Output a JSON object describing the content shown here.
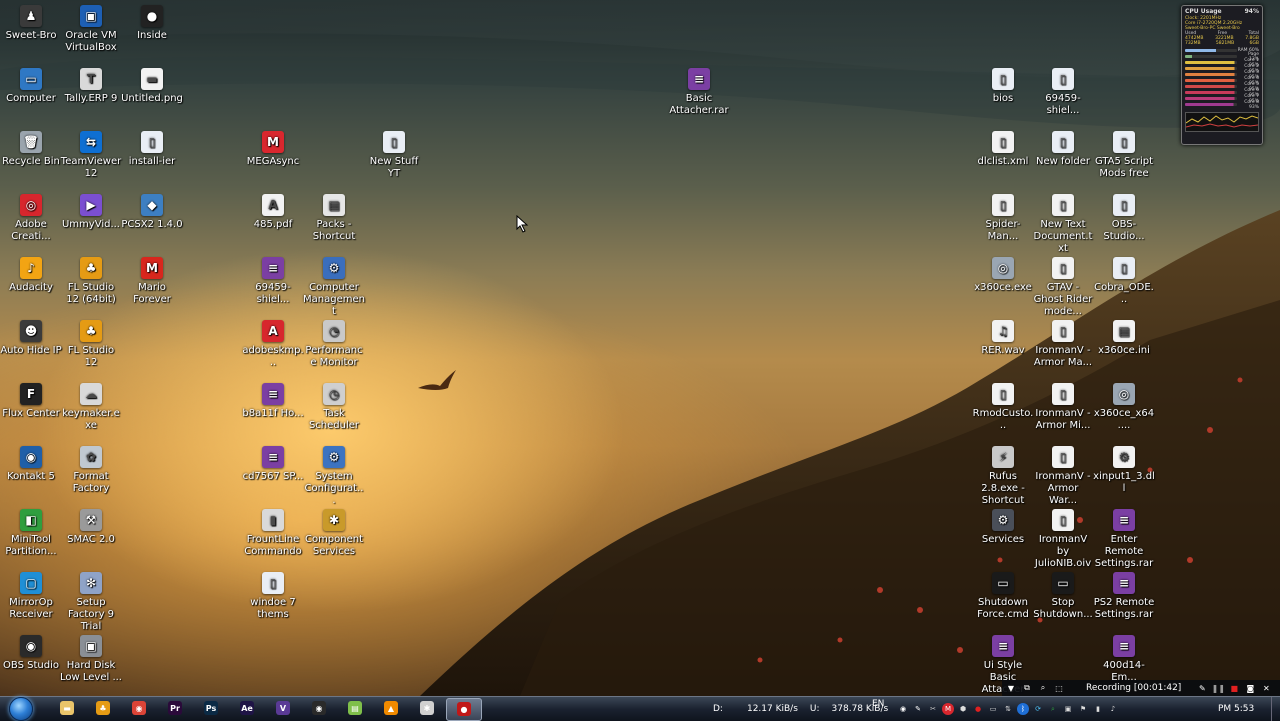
{
  "desktop": {
    "icons": [
      {
        "label": "Sweet-Bro",
        "icon": "user-folder-icon",
        "color": "#3a3a3a",
        "glyph": "♟"
      },
      {
        "label": "Oracle VM VirtualBox",
        "icon": "virtualbox-icon",
        "color": "#1d5fb4",
        "glyph": "▣"
      },
      {
        "label": "Inside",
        "icon": "game-icon",
        "color": "#222222",
        "glyph": "●"
      },
      {
        "label": "Computer",
        "icon": "computer-icon",
        "color": "#2f78c4",
        "glyph": "▭"
      },
      {
        "label": "Tally.ERP 9",
        "icon": "tally-icon",
        "color": "#d9d9d9",
        "glyph": "T"
      },
      {
        "label": "Untitled.png",
        "icon": "image-file-icon",
        "color": "#f2f2f2",
        "glyph": "▬"
      },
      {
        "label": "Recycle Bin",
        "icon": "recycle-bin-icon",
        "color": "#9aa4ad",
        "glyph": "🗑"
      },
      {
        "label": "TeamViewer 12",
        "icon": "teamviewer-icon",
        "color": "#0e6fd2",
        "glyph": "⇆"
      },
      {
        "label": "install-ier",
        "icon": "folder-icon",
        "color": "#e9eef5",
        "glyph": "▯"
      },
      {
        "label": "MEGAsync",
        "icon": "mega-icon",
        "color": "#d9272e",
        "glyph": "M"
      },
      {
        "label": "New Stuff YT",
        "icon": "folder-icon",
        "color": "#e9eef5",
        "glyph": "▯"
      },
      {
        "label": "Basic Attacher.rar",
        "icon": "rar-archive-icon",
        "color": "#7b3fa3",
        "glyph": "≡"
      },
      {
        "label": "bios",
        "icon": "folder-icon",
        "color": "#e9eef5",
        "glyph": "▯"
      },
      {
        "label": "69459-shiel...",
        "icon": "folder-icon",
        "color": "#e9eef5",
        "glyph": "▯"
      },
      {
        "label": "Adobe Creati...",
        "icon": "adobe-cc-icon",
        "color": "#d7262d",
        "glyph": "◎"
      },
      {
        "label": "UmmyVid...",
        "icon": "ummy-icon",
        "color": "#7b4fd1",
        "glyph": "▶"
      },
      {
        "label": "PCSX2 1.4.0",
        "icon": "pcsx2-icon",
        "color": "#3d7fc2",
        "glyph": "◆"
      },
      {
        "label": "485.pdf",
        "icon": "pdf-file-icon",
        "color": "#f2f2f2",
        "glyph": "A"
      },
      {
        "label": "Packs - Shortcut",
        "icon": "shortcut-icon",
        "color": "#e6e6e6",
        "glyph": "▤"
      },
      {
        "label": "69459-shiel...",
        "icon": "rar-archive-icon",
        "color": "#7b3fa3",
        "glyph": "≡"
      },
      {
        "label": "Computer Management",
        "icon": "computer-management-icon",
        "color": "#3a6ebd",
        "glyph": "⚙"
      },
      {
        "label": "Audacity",
        "icon": "audacity-icon",
        "color": "#f2a413",
        "glyph": "♪"
      },
      {
        "label": "FL Studio 12 (64bit)",
        "icon": "fl-studio-icon",
        "color": "#e59b14",
        "glyph": "♣"
      },
      {
        "label": "Mario Forever",
        "icon": "mario-icon",
        "color": "#d8261d",
        "glyph": "M"
      },
      {
        "label": "Auto Hide IP",
        "icon": "auto-hide-ip-icon",
        "color": "#3b3b3b",
        "glyph": "☻"
      },
      {
        "label": "FL Studio 12",
        "icon": "fl-studio-icon",
        "color": "#e59b14",
        "glyph": "♣"
      },
      {
        "label": "adobeskmp...",
        "icon": "adobe-file-icon",
        "color": "#d7262d",
        "glyph": "A"
      },
      {
        "label": "Performance Monitor",
        "icon": "performance-monitor-icon",
        "color": "#c9c9c9",
        "glyph": "◔"
      },
      {
        "label": "Flux Center",
        "icon": "flux-icon",
        "color": "#222222",
        "glyph": "F"
      },
      {
        "label": "keymaker.exe",
        "icon": "keymaker-icon",
        "color": "#d9d9d9",
        "glyph": "☁"
      },
      {
        "label": "b8a11f Ho...",
        "icon": "rar-archive-icon",
        "color": "#7b3fa3",
        "glyph": "≡"
      },
      {
        "label": "Task Scheduler",
        "icon": "task-scheduler-icon",
        "color": "#cfcfcf",
        "glyph": "◷"
      },
      {
        "label": "Kontakt 5",
        "icon": "kontakt-icon",
        "color": "#1f5fa8",
        "glyph": "◉"
      },
      {
        "label": "Format Factory",
        "icon": "format-factory-icon",
        "color": "#c0c8d0",
        "glyph": "✿"
      },
      {
        "label": "cd7567 SP...",
        "icon": "rar-archive-icon",
        "color": "#7b3fa3",
        "glyph": "≡"
      },
      {
        "label": "System Configurat...",
        "icon": "system-config-icon",
        "color": "#3c73c0",
        "glyph": "⚙"
      },
      {
        "label": "MiniTool Partition...",
        "icon": "minitool-icon",
        "color": "#2f9e3f",
        "glyph": "◧"
      },
      {
        "label": "SMAC 2.0",
        "icon": "smac-icon",
        "color": "#9a9a9a",
        "glyph": "⚒"
      },
      {
        "label": "FrountLine Commando",
        "icon": "game-shortcut-icon",
        "color": "#d9d9d9",
        "glyph": "▮"
      },
      {
        "label": "Component Services",
        "icon": "component-services-icon",
        "color": "#c99a2a",
        "glyph": "✱"
      },
      {
        "label": "MirrorOp Receiver",
        "icon": "mirrorop-icon",
        "color": "#1f8fd6",
        "glyph": "▢"
      },
      {
        "label": "Setup Factory 9 Trial",
        "icon": "setup-factory-icon",
        "color": "#8fa3c7",
        "glyph": "✻"
      },
      {
        "label": "windoe 7 thems",
        "icon": "folder-icon",
        "color": "#e9eef5",
        "glyph": "▯"
      },
      {
        "label": "OBS Studio",
        "icon": "obs-icon",
        "color": "#2a2a2a",
        "glyph": "◉"
      },
      {
        "label": "Hard Disk Low Level ...",
        "icon": "hard-disk-icon",
        "color": "#8a8f96",
        "glyph": "▣"
      },
      {
        "label": "dlclist.xml",
        "icon": "xml-file-icon",
        "color": "#f2f2f2",
        "glyph": "▯"
      },
      {
        "label": "New folder",
        "icon": "folder-icon",
        "color": "#e9eef5",
        "glyph": "▯"
      },
      {
        "label": "GTA5 Script Mods free",
        "icon": "folder-icon",
        "color": "#e9eef5",
        "glyph": "▯"
      },
      {
        "label": "Spider-Man...",
        "icon": "text-file-icon",
        "color": "#f2f2f2",
        "glyph": "▯"
      },
      {
        "label": "New Text Document.txt",
        "icon": "text-file-icon",
        "color": "#f2f2f2",
        "glyph": "▯"
      },
      {
        "label": "OBS-Studio...",
        "icon": "folder-icon",
        "color": "#e9eef5",
        "glyph": "▯"
      },
      {
        "label": "x360ce.exe",
        "icon": "gamepad-icon",
        "color": "#9aa6b3",
        "glyph": "◎"
      },
      {
        "label": "GTAV - Ghost Rider mode...",
        "icon": "text-file-icon",
        "color": "#f2f2f2",
        "glyph": "▯"
      },
      {
        "label": "Cobra_ODE...",
        "icon": "folder-icon",
        "color": "#e9eef5",
        "glyph": "▯"
      },
      {
        "label": "RER.wav",
        "icon": "audio-file-icon",
        "color": "#f2f2f2",
        "glyph": "♫"
      },
      {
        "label": "IronmanV - Armor Ma...",
        "icon": "text-file-icon",
        "color": "#f2f2f2",
        "glyph": "▯"
      },
      {
        "label": "x360ce.ini",
        "icon": "ini-file-icon",
        "color": "#f2f2f2",
        "glyph": "▤"
      },
      {
        "label": "RmodCusto...",
        "icon": "text-file-icon",
        "color": "#f2f2f2",
        "glyph": "▯"
      },
      {
        "label": "IronmanV - Armor Mi...",
        "icon": "text-file-icon",
        "color": "#f2f2f2",
        "glyph": "▯"
      },
      {
        "label": "x360ce_x64....",
        "icon": "gamepad-icon",
        "color": "#9aa6b3",
        "glyph": "◎"
      },
      {
        "label": "Rufus 2.8.exe - Shortcut",
        "icon": "rufus-icon",
        "color": "#c9c9c9",
        "glyph": "⚡"
      },
      {
        "label": "IronmanV - Armor War...",
        "icon": "text-file-icon",
        "color": "#f2f2f2",
        "glyph": "▯"
      },
      {
        "label": "xinput1_3.dll",
        "icon": "dll-file-icon",
        "color": "#f2f2f2",
        "glyph": "⚙"
      },
      {
        "label": "Services",
        "icon": "services-gear-icon",
        "color": "#4a4f59",
        "glyph": "⚙"
      },
      {
        "label": "IronmanV by JulioNIB.oiv",
        "icon": "text-file-icon",
        "color": "#f2f2f2",
        "glyph": "▯"
      },
      {
        "label": "Enter Remote Settings.rar",
        "icon": "rar-archive-icon",
        "color": "#7b3fa3",
        "glyph": "≡"
      },
      {
        "label": "Shutdown Force.cmd",
        "icon": "cmd-file-icon",
        "color": "#1a1a1a",
        "glyph": "▭"
      },
      {
        "label": "Stop Shutdown...",
        "icon": "cmd-file-icon",
        "color": "#1a1a1a",
        "glyph": "▭"
      },
      {
        "label": "PS2 Remote Settings.rar",
        "icon": "rar-archive-icon",
        "color": "#7b3fa3",
        "glyph": "≡"
      },
      {
        "label": "Ui Style Basic Attacher",
        "icon": "rar-archive-icon",
        "color": "#7b3fa3",
        "glyph": "≡"
      },
      {
        "label": "400d14-Em...",
        "icon": "rar-archive-icon",
        "color": "#7b3fa3",
        "glyph": "≡"
      }
    ]
  },
  "gadget": {
    "title": "CPU Usage",
    "percent": "94%",
    "lines": [
      "Clock: 2201MHz",
      "Core i7-2720QM 2.20GHz",
      "Sweet-Bro-PC Sweet-Bro"
    ],
    "table_header": [
      "Used",
      "Free",
      "Total"
    ],
    "table_rows": [
      [
        "4742MB",
        "3221MB",
        "7.8GB"
      ],
      [
        "732MB",
        "5821MB",
        "6GB"
      ]
    ],
    "bars": [
      {
        "label": "RAM",
        "value": "60%"
      },
      {
        "label": "Page",
        "value": "13%"
      },
      {
        "label": "Core 1",
        "value": "95%"
      },
      {
        "label": "Core 2",
        "value": "95%"
      },
      {
        "label": "Core 3",
        "value": "95%"
      },
      {
        "label": "Core 4",
        "value": "95%"
      },
      {
        "label": "Core 5",
        "value": "95%"
      },
      {
        "label": "Core 6",
        "value": "95%"
      },
      {
        "label": "Core 7",
        "value": "95%"
      },
      {
        "label": "Core 8",
        "value": "93%"
      }
    ]
  },
  "recording": {
    "text": "Recording [00:01:42]"
  },
  "taskbar": {
    "pinned": [
      {
        "name": "explorer",
        "icon": "folder-icon",
        "color": "#e9c46a",
        "glyph": "▬"
      },
      {
        "name": "fl-studio",
        "icon": "fl-studio-icon",
        "color": "#e59b14",
        "glyph": "♣"
      },
      {
        "name": "chrome",
        "icon": "chrome-icon",
        "color": "#db4437",
        "glyph": "◉"
      },
      {
        "name": "premiere",
        "icon": "premiere-icon",
        "color": "#2a0a3a",
        "glyph": "Pr"
      },
      {
        "name": "photoshop",
        "icon": "photoshop-icon",
        "color": "#0b2a45",
        "glyph": "Ps"
      },
      {
        "name": "after-effects",
        "icon": "after-effects-icon",
        "color": "#1f1446",
        "glyph": "Ae"
      },
      {
        "name": "visual-studio",
        "icon": "visual-studio-icon",
        "color": "#5a3a96",
        "glyph": "V"
      },
      {
        "name": "obs",
        "icon": "obs-icon",
        "color": "#2a2a2a",
        "glyph": "◉"
      },
      {
        "name": "notepad",
        "icon": "notepad-icon",
        "color": "#7fbf4a",
        "glyph": "▤"
      },
      {
        "name": "vlc",
        "icon": "vlc-icon",
        "color": "#f08a00",
        "glyph": "▲"
      },
      {
        "name": "tool",
        "icon": "app-icon",
        "color": "#d0d0d0",
        "glyph": "✱"
      },
      {
        "name": "recorder",
        "icon": "recorder-icon",
        "color": "#c01818",
        "glyph": "●",
        "active": true
      }
    ],
    "net_drive": "D:",
    "download": "12.17 KiB/s",
    "upload_label": "U:",
    "upload": "378.78 KiB/s",
    "language": "EN",
    "clock": "PM 5:53"
  }
}
